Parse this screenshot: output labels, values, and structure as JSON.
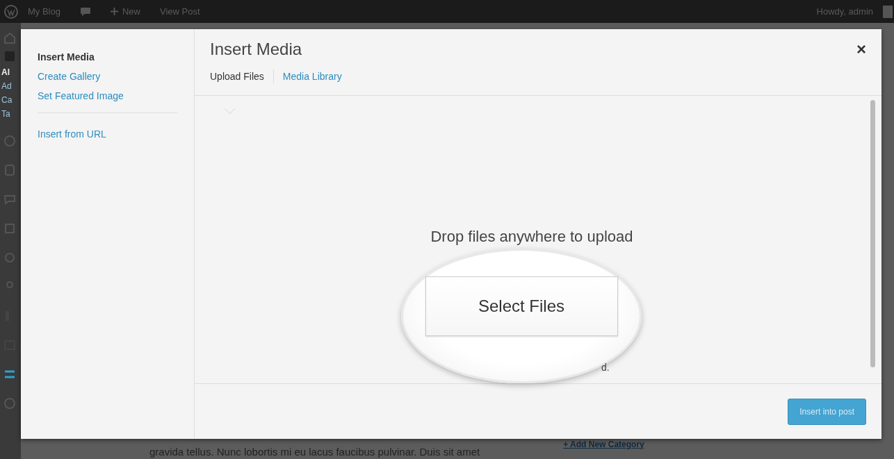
{
  "admin_bar": {
    "site": "My Blog",
    "new": "New",
    "view": "View Post",
    "greeting": "Howdy, admin"
  },
  "background": {
    "menu_fragments": [
      "Al",
      "Ad",
      "Ca",
      "Ta"
    ],
    "side_link": "+ Add New Category",
    "content_text": "gravida tellus. Nunc lobortis mi eu lacus faucibus pulvinar. Duis sit amet"
  },
  "modal": {
    "sidebar": {
      "sections": [
        [
          {
            "label": "Insert Media",
            "selected": true
          },
          {
            "label": "Create Gallery",
            "selected": false
          },
          {
            "label": "Set Featured Image",
            "selected": false
          }
        ],
        [
          {
            "label": "Insert from URL",
            "selected": false
          }
        ]
      ]
    },
    "title": "Insert Media",
    "close": "×",
    "tabs": [
      {
        "label": "Upload Files",
        "selected": true
      },
      {
        "label": "Media Library",
        "selected": false
      }
    ],
    "uploader": {
      "instruction": "Drop files anywhere to upload",
      "button": "Select Files",
      "hidden_fragment": "d."
    },
    "footer": {
      "button": "Insert into post"
    }
  }
}
